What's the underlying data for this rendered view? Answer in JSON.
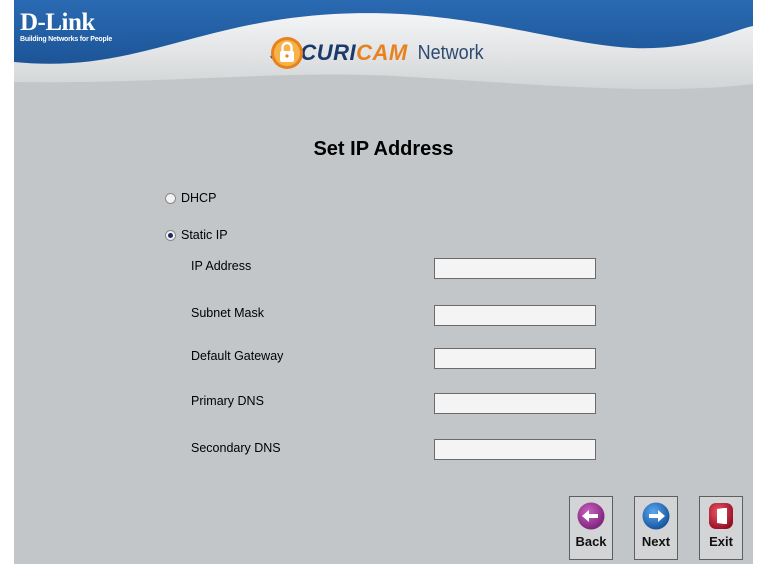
{
  "header": {
    "brand_name": "D-Link",
    "brand_tagline": "Building Networks for People",
    "product_securi": "SECURI",
    "product_cam": "CAM",
    "product_network": "Network"
  },
  "page": {
    "title": "Set IP Address"
  },
  "mode": {
    "options": [
      {
        "label": "DHCP",
        "selected": false
      },
      {
        "label": "Static IP",
        "selected": true
      }
    ]
  },
  "fields": [
    {
      "label": "IP Address",
      "value": ""
    },
    {
      "label": "Subnet Mask",
      "value": ""
    },
    {
      "label": "Default Gateway",
      "value": ""
    },
    {
      "label": "Primary DNS",
      "value": ""
    },
    {
      "label": "Secondary DNS",
      "value": ""
    }
  ],
  "nav": {
    "back_label": "Back",
    "next_label": "Next",
    "exit_label": "Exit"
  },
  "colors": {
    "background": "#c3c6c8",
    "header_blue": "#1e5aa0",
    "back_purple": "#8a2e86",
    "next_blue": "#1e63b0",
    "exit_red": "#b0152c"
  }
}
